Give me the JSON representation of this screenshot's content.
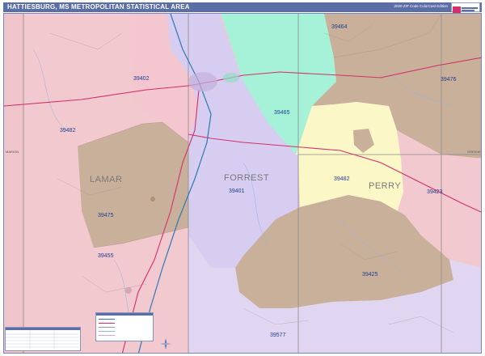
{
  "header": {
    "title": "HATTIESBURG, MS METROPOLITAN STATISTICAL AREA",
    "edition": "2020 ZIP Code ColorCast Edition"
  },
  "counties": {
    "lamar": "LAMAR",
    "forrest": "FORREST",
    "perry": "PERRY",
    "marion": "MARION",
    "greene": "GREENE"
  },
  "zip_codes": {
    "z39464": "39464",
    "z39402": "39402",
    "z39476": "39476",
    "z39465": "39465",
    "z39482_west": "39482",
    "z39401": "39401",
    "z39482_east": "39482",
    "z39423": "39423",
    "z39475": "39475",
    "z39455": "39455",
    "z39425": "39425",
    "z39577": "39577"
  },
  "colors": {
    "pink": "#f2c9cf",
    "lavender": "#d7cdf0",
    "mint": "#a6f2d8",
    "tan": "#c9b09a",
    "cream": "#fbf7c6",
    "highway_red": "#d2306a",
    "interstate_blue": "#2f78b8",
    "title_bar": "#5b6ea8"
  },
  "icons": {
    "compass": "compass-rose-icon",
    "logo": "publisher-logo-icon"
  }
}
